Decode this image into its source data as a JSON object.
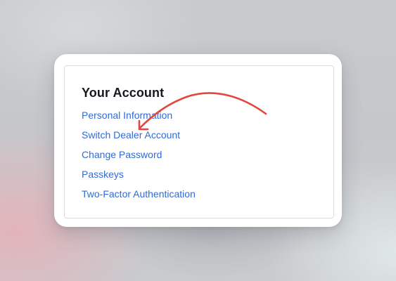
{
  "account": {
    "title": "Your Account",
    "links": [
      {
        "label": "Personal Information"
      },
      {
        "label": "Switch Dealer Account"
      },
      {
        "label": "Change Password"
      },
      {
        "label": "Passkeys"
      },
      {
        "label": "Two-Factor Authentication"
      }
    ]
  },
  "colors": {
    "link": "#2f6bd6",
    "title": "#15191f",
    "annotation_arrow": "#e2473f"
  },
  "annotation": {
    "icon": "curved-arrow-icon",
    "points_to": "Switch Dealer Account"
  }
}
